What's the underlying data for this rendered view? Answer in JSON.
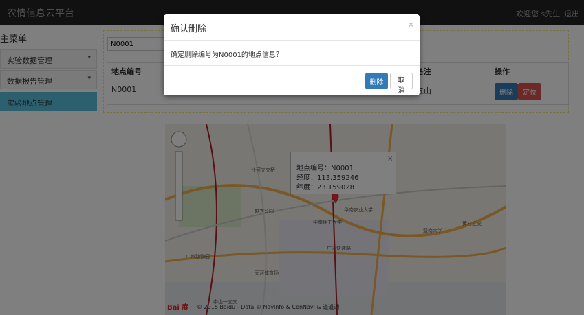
{
  "header": {
    "brand": "农情信息云平台",
    "welcome": "欢迎您 s先生",
    "logout": "退出"
  },
  "sidebar": {
    "title": "主菜单",
    "items": [
      {
        "label": "实验数据管理",
        "caret": "▾"
      },
      {
        "label": "数据报告管理",
        "caret": "▾"
      },
      {
        "label": "实验地点管理"
      }
    ]
  },
  "search": {
    "value": "N0001"
  },
  "table": {
    "headers": [
      "地点编号",
      "备注",
      "操作"
    ],
    "rows": [
      {
        "id": "N0001",
        "note": "五山",
        "delete_label": "删除",
        "locate_label": "定位"
      }
    ]
  },
  "map": {
    "info": {
      "id_line": "地点编号：N0001",
      "lng_line": "经度：113.359246",
      "lat_line": "纬度：23.159028",
      "close": "×"
    },
    "labels": [
      "沙河立交桥",
      "广园快速路",
      "华南农业大学",
      "华南理工大学",
      "暨南大学",
      "黄村立交",
      "天河体育场",
      "广州动物园",
      "越秀公园",
      "中山一立交"
    ],
    "logo": "Bai 度",
    "copyright": "© 2015 Baidu - Data © NavInfo & CenNavi & 道道通"
  },
  "modal": {
    "title": "确认删除",
    "close": "×",
    "message": "确定删除编号为N0001的地点信息？",
    "confirm": "删除",
    "cancel": "取消"
  },
  "colors": {
    "primary": "#337ab7",
    "danger": "#d9534f",
    "info": "#5bc0de",
    "navbar": "#222222"
  }
}
